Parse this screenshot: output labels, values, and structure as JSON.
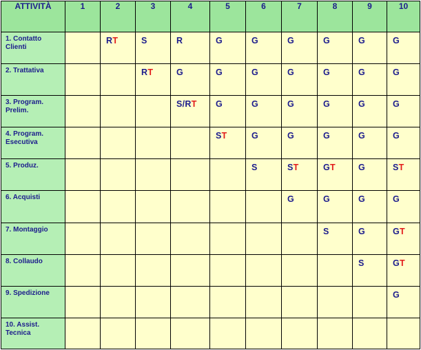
{
  "header": {
    "activity_label": "ATTIVITÀ",
    "columns": [
      "1",
      "2",
      "3",
      "4",
      "5",
      "6",
      "7",
      "8",
      "9",
      "10"
    ]
  },
  "colors": {
    "header_bg": "#9ce59c",
    "activity_bg": "#b5efb5",
    "cell_bg": "#ffffcc",
    "text_blue": "#1c1c8c",
    "text_red": "#e21b1b"
  },
  "rows": [
    {
      "label": "1.  Contatto\nClienti",
      "cells": [
        "",
        "RT",
        "S",
        "R",
        "G",
        "G",
        "G",
        "G",
        "G",
        "G"
      ]
    },
    {
      "label": "2. Trattativa",
      "cells": [
        "",
        "",
        "RT",
        "G",
        "G",
        "G",
        "G",
        "G",
        "G",
        "G"
      ]
    },
    {
      "label": "3. Program.\nPrelim.",
      "cells": [
        "",
        "",
        "",
        "S/RT",
        "G",
        "G",
        "G",
        "G",
        "G",
        "G"
      ]
    },
    {
      "label": "4. Program.\nEsecutiva",
      "cells": [
        "",
        "",
        "",
        "",
        "ST",
        "G",
        "G",
        "G",
        "G",
        "G"
      ]
    },
    {
      "label": "5.  Produz.",
      "cells": [
        "",
        "",
        "",
        "",
        "",
        "S",
        "ST",
        "GT",
        "G",
        "ST"
      ]
    },
    {
      "label": "6.  Acquisti",
      "cells": [
        "",
        "",
        "",
        "",
        "",
        "",
        "G",
        "G",
        "G",
        "G"
      ]
    },
    {
      "label": "7. Montaggio",
      "cells": [
        "",
        "",
        "",
        "",
        "",
        "",
        "",
        "S",
        "G",
        "GT"
      ]
    },
    {
      "label": "8.  Collaudo",
      "cells": [
        "",
        "",
        "",
        "",
        "",
        "",
        "",
        "",
        "S",
        "GT"
      ]
    },
    {
      "label": "9.  Spedizione",
      "cells": [
        "",
        "",
        "",
        "",
        "",
        "",
        "",
        "",
        "",
        "G"
      ]
    },
    {
      "label": "10.  Assist.\nTecnica",
      "cells": [
        "",
        "",
        "",
        "",
        "",
        "",
        "",
        "",
        "",
        ""
      ]
    }
  ]
}
